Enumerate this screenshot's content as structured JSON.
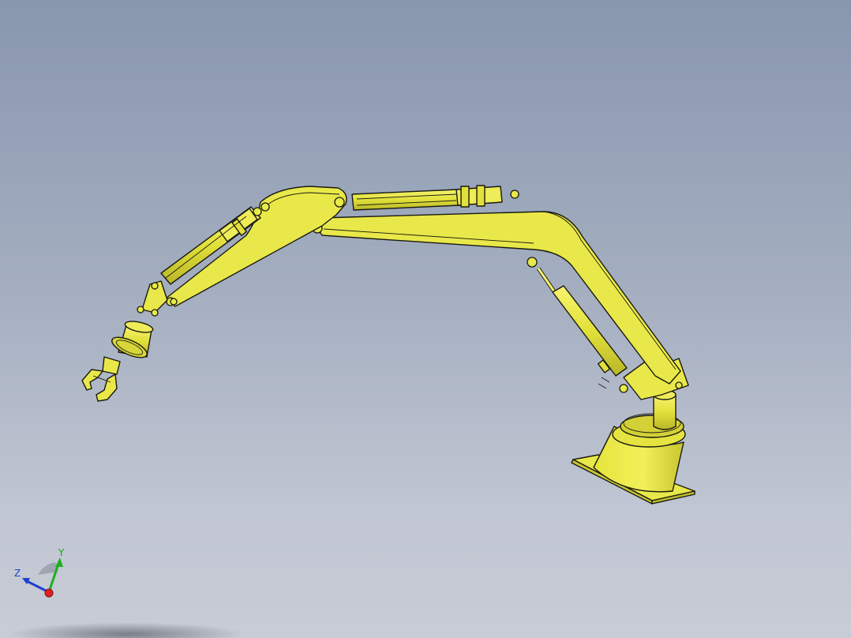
{
  "viewport": {
    "background_top": "#8896ae",
    "background_bottom": "#c8ccd6",
    "model_color": "#e9e84a",
    "edge_color": "#1a1a10"
  },
  "triad": {
    "x_label": "",
    "y_label": "Y",
    "z_label": "Z",
    "x_color": "#e02020",
    "y_color": "#20b020",
    "z_color": "#2040d0"
  }
}
